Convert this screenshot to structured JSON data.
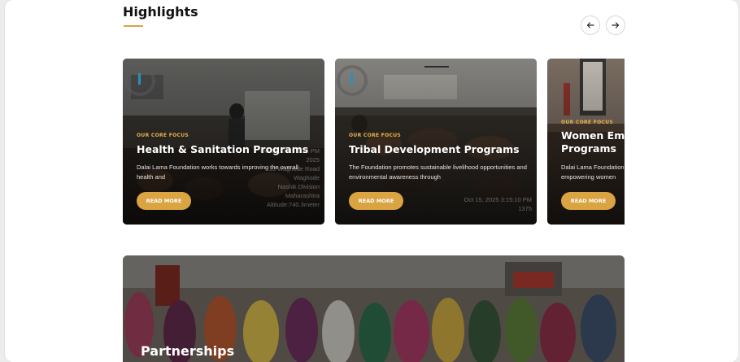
{
  "highlights": {
    "title": "Highlights",
    "prev_icon": "arrow-left-icon",
    "next_icon": "arrow-right-icon",
    "accent_color": "#d9a441",
    "cards": [
      {
        "eyebrow": "OUR CORE FOCUS",
        "title": "Health & Sanitation Programs",
        "description": "Dalai Lama Foundation works towards improving the overall health and",
        "button": "READ MORE",
        "photo_stamp": "Oct 15, 2025 1:32 PM\n2025\n13 Waghode Road\nWaghode\nNashik Division\nMaharashtra\nAltitude:740.3meter"
      },
      {
        "eyebrow": "OUR CORE FOCUS",
        "title": "Tribal Development Programs",
        "description": "The Foundation promotes sustainable livelihood opportunities and environmental awareness through",
        "button": "READ MORE",
        "photo_stamp": "Oct 15, 2025 3:15:10 PM\n1375"
      },
      {
        "eyebrow": "OUR CORE FOCUS",
        "title": "Women Em Programs",
        "description": "Dalai Lama Foundation empowering women",
        "button": "READ MORE",
        "photo_stamp": ""
      }
    ]
  },
  "partnerships": {
    "title": "Partnerships"
  }
}
